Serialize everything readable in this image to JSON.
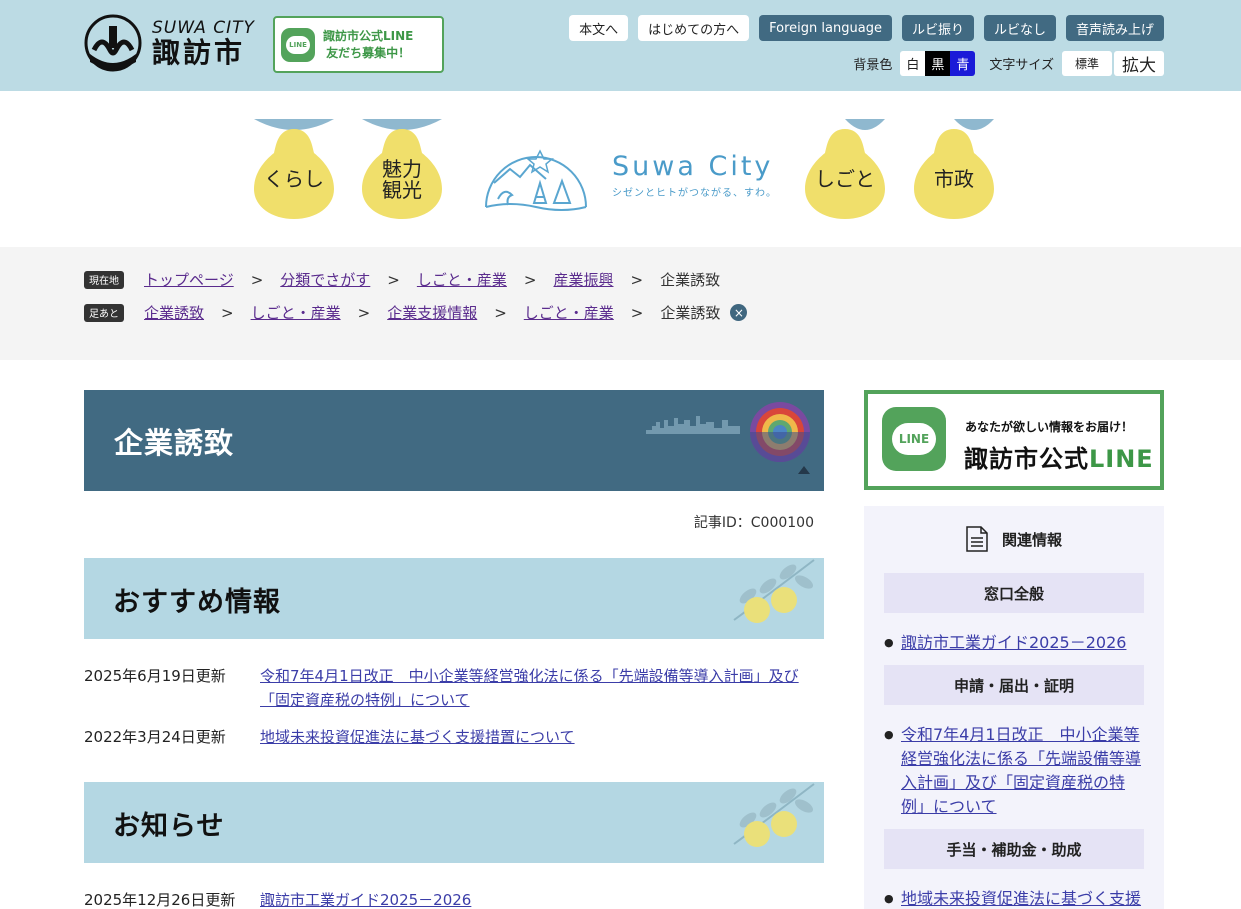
{
  "header": {
    "logo_en": "SUWA CITY",
    "logo_ja": "諏訪市",
    "line_banner_lines": [
      "諏訪市公式LINE",
      "友だち募集中！"
    ],
    "line_icon": "LINE",
    "util_buttons": [
      "本文へ",
      "はじめての方へ",
      "Foreign language",
      "ルビ振り",
      "ルビなし",
      "音声読み上げ"
    ],
    "bg_color_label": "背景色",
    "bg_options": [
      "白",
      "黒",
      "青"
    ],
    "text_size_label": "文字サイズ",
    "size_options": [
      "標準",
      "拡大"
    ]
  },
  "nav": {
    "items": [
      "くらし",
      "魅力観光",
      "しごと",
      "市政"
    ],
    "item_lines": [
      [
        "くらし"
      ],
      [
        "魅力",
        "観光"
      ],
      [
        "しごと"
      ],
      [
        "市政"
      ]
    ],
    "brand_en": "Suwa City",
    "brand_sub": "シゼンとヒトがつながる、すわ。"
  },
  "breadcrumb": {
    "current_tag": "現在地",
    "current_path": [
      "トップページ",
      "分類でさがす",
      "しごと・産業",
      "産業振興"
    ],
    "current_page": "企業誘致",
    "history_tag": "足あと",
    "history_path": [
      "企業誘致",
      "しごと・産業",
      "企業支援情報",
      "しごと・産業"
    ],
    "history_page": "企業誘致",
    "separator": ">",
    "clear": "×"
  },
  "main": {
    "title": "企業誘致",
    "article_id": "記事ID：C000100",
    "sections": [
      {
        "heading": "おすすめ情報",
        "items": [
          {
            "date": "2025年6月19日更新",
            "title": "令和7年4月1日改正　中小企業等経営強化法に係る「先端設備等導入計画」及び「固定資産税の特例」について"
          },
          {
            "date": "2022年3月24日更新",
            "title": "地域未来投資促進法に基づく支援措置について"
          }
        ]
      },
      {
        "heading": "お知らせ",
        "items": [
          {
            "date": "2025年12月26日更新",
            "title": "諏訪市工業ガイド2025－2026"
          }
        ]
      }
    ]
  },
  "sidebar": {
    "line_sub": "あなたが欲しい情報をお届け！",
    "line_main_prefix": "諏訪市公式",
    "line_main_accent": "LINE",
    "line_icon": "LINE",
    "related_title": "関連情報",
    "categories": [
      {
        "name": "窓口全般",
        "links": [
          "諏訪市工業ガイド2025－2026"
        ]
      },
      {
        "name": "申請・届出・証明",
        "links": [
          "令和7年4月1日改正　中小企業等経営強化法に係る「先端設備等導入計画」及び「固定資産税の特例」について"
        ]
      },
      {
        "name": "手当・補助金・助成",
        "links": [
          "地域未来投資促進法に基づく支援"
        ]
      }
    ]
  },
  "colors": {
    "header_bg": "#bcdbe4",
    "title_bg": "#416a82",
    "section_bg": "#b4d7e3",
    "pear_yellow": "#f0df6b",
    "line_green": "#53a35b",
    "link": "#3b3da8"
  }
}
